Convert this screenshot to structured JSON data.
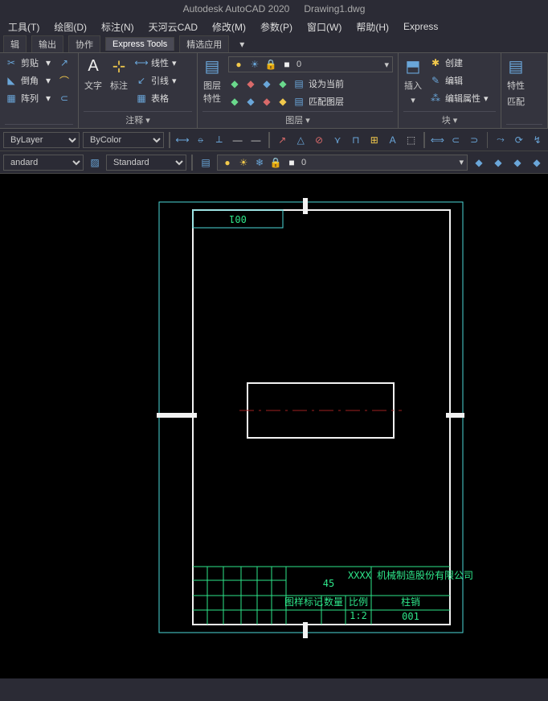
{
  "title": {
    "app": "Autodesk AutoCAD 2020",
    "file": "Drawing1.dwg"
  },
  "menu": [
    "工具(T)",
    "绘图(D)",
    "标注(N)",
    "天河云CAD",
    "修改(M)",
    "参数(P)",
    "窗口(W)",
    "帮助(H)",
    "Express"
  ],
  "tabs": [
    "辑",
    "输出",
    "协作",
    "Express Tools",
    "精选应用"
  ],
  "ribbon": {
    "modify": {
      "title": "",
      "items": [
        "剪贴",
        "倒角",
        "阵列"
      ]
    },
    "annotate": {
      "title": "注释 ▾",
      "text": "文字",
      "dim": "标注",
      "items": [
        "线性",
        "引线",
        "表格"
      ]
    },
    "layer": {
      "title": "图层 ▾",
      "props": "图层\n特性",
      "current": "设为当前",
      "match": "匹配图层",
      "value": "0"
    },
    "block": {
      "title": "块 ▾",
      "insert": "插入",
      "items": [
        "创建",
        "编辑",
        "编辑属性"
      ]
    },
    "props": {
      "title": "",
      "l1": "特性",
      "l2": "匹配"
    }
  },
  "toolbars": {
    "layer_sel": "ByLayer",
    "color_sel": "ByColor",
    "style_sel": "andard",
    "std_sel": "Standard",
    "layer_dd": "0"
  },
  "drawing": {
    "top_number": "001",
    "tb_center": "45",
    "tb_company": "XXXX 机械制造股份有限公司",
    "tb_partname": "柱销",
    "tb_partno": "001",
    "tb_row3_a": "图样标记",
    "tb_row3_b": "数量",
    "tb_row3_c": "比例",
    "tb_row3_scale": "1:2"
  }
}
